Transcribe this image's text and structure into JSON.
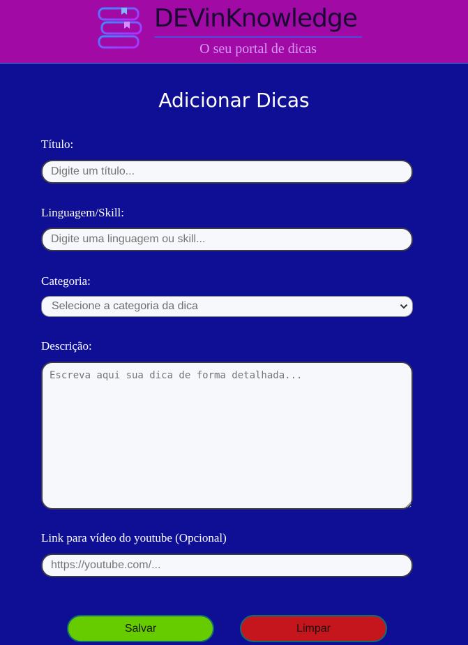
{
  "header": {
    "brand": "DEVinKnowledge",
    "tagline": "O seu portal de dicas",
    "logo_icon": "books-stack-icon"
  },
  "page": {
    "title": "Adicionar Dicas"
  },
  "form": {
    "title": {
      "label": "Título:",
      "placeholder": "Digite um título..."
    },
    "skill": {
      "label": "Linguagem/Skill:",
      "placeholder": "Digite uma linguagem ou skill..."
    },
    "category": {
      "label": "Categoria:",
      "selected": "Selecione a categoria da dica"
    },
    "description": {
      "label": "Descrição:",
      "placeholder": "Escreva aqui sua dica de forma detalhada..."
    },
    "video": {
      "label": "Link para vídeo do youtube (Opcional)",
      "placeholder": "https://youtube.com/..."
    },
    "save_label": "Salvar",
    "clear_label": "Limpar"
  },
  "colors": {
    "background": "#0e0f94",
    "header": "#a20aa6",
    "save_button": "#66cc00",
    "clear_button": "#c4161c"
  }
}
